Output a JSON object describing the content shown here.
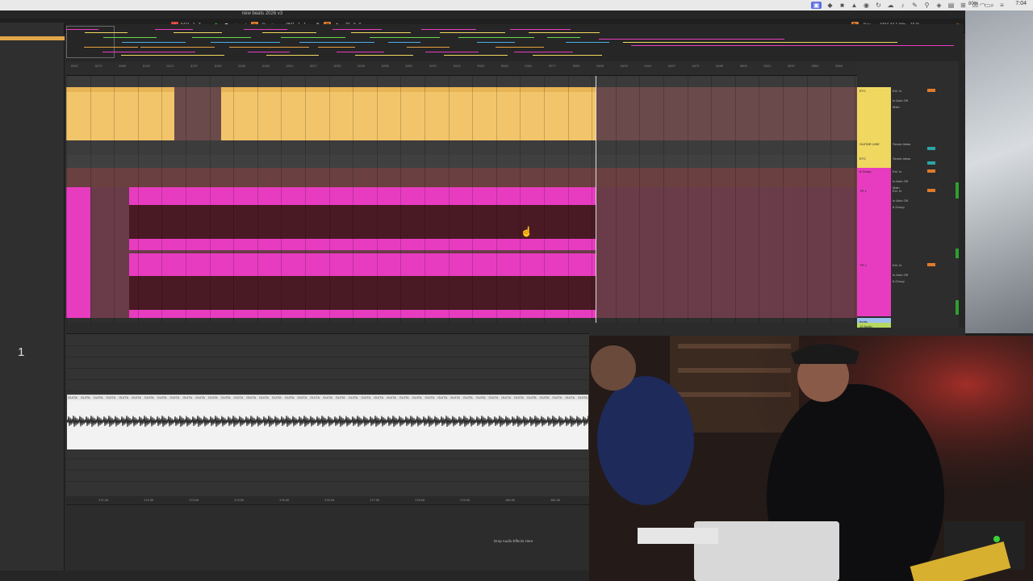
{
  "menubar": {
    "battery": "80%",
    "clock": "7:04",
    "icons": [
      "screen-record-icon",
      "diamond-icon",
      "stop-icon",
      "warning-icon",
      "drop-icon",
      "sync-icon",
      "cloud-icon",
      "bell-icon",
      "tag-icon",
      "pin-icon",
      "shield-icon",
      "lock-icon",
      "download-icon",
      "grid-icon",
      "x-icon",
      "screen-icon",
      "wifi-icon",
      "search-icon",
      "control-center-icon"
    ]
  },
  "app": {
    "title": "new beats 2026 v3"
  },
  "transport": {
    "position": "5411 .  1 .  3",
    "loop_start": "4841 .  1 .  1",
    "loop_length": "32 .  0 .  0",
    "key_label": "Key",
    "cpu": "4404   44.1 kHz",
    "disk": "16 %",
    "colors": {
      "play": "#3ad13a",
      "record": "#e0443a",
      "accent": "#e07a2a"
    }
  },
  "ruler": {
    "ticks": [
      "5057",
      "5073",
      "5089",
      "5105",
      "5121",
      "5137",
      "5153",
      "5169",
      "5185",
      "5201",
      "5217",
      "5233",
      "5249",
      "5265",
      "5281",
      "5297",
      "5313",
      "5329",
      "5345",
      "5361",
      "5377",
      "5393",
      "5409",
      "5425",
      "5441",
      "5457",
      "5473",
      "5489",
      "5505",
      "5521",
      "5537",
      "5553",
      "5569"
    ]
  },
  "tracks": [
    {
      "label": "ETC",
      "color": "#f0d860"
    },
    {
      "label": "GUITAR LINE",
      "color": "#f0d860"
    },
    {
      "label": "ETC",
      "color": "#f0d860"
    },
    {
      "label": "8 Group",
      "color": "#e83cc0"
    },
    {
      "label": "TR 1",
      "color": "#e83cc0"
    },
    {
      "label": "TR 2",
      "color": "#e83cc0"
    },
    {
      "label": "beats",
      "color": "#9cc0f0"
    },
    {
      "label": "12 Audio",
      "color": "#b6d860"
    }
  ],
  "mixer": {
    "ext_in": "Ext. In",
    "in_auto_off": "In  Auto  Off",
    "group": "8-Group",
    "main": "Main",
    "sends": "Sends Ideas"
  },
  "detail": {
    "clip_name": "GUITA",
    "ruler": [
      "171.00",
      "172.00",
      "173.00",
      "174.00",
      "175.00",
      "176.00",
      "177.00",
      "178.00",
      "179.00",
      "180.00",
      "181.00"
    ]
  },
  "devices": {
    "drop_text": "Drop Audio Effects Here"
  },
  "browser": {
    "big_label": "1"
  }
}
